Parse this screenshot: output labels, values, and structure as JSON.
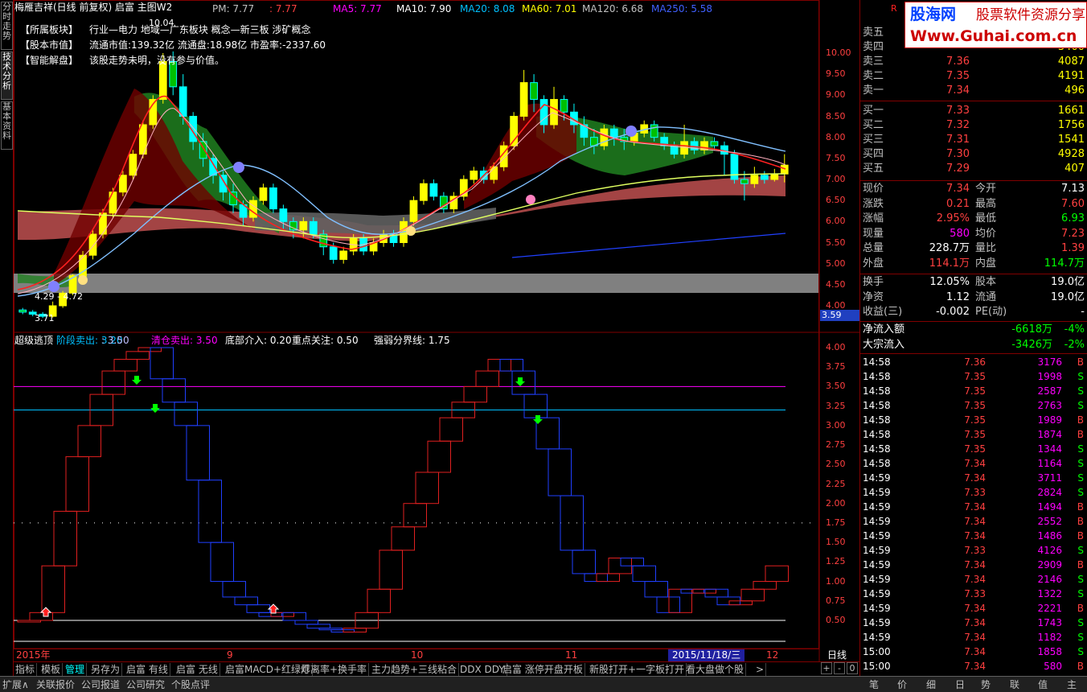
{
  "window": {
    "title": "梅雁吉祥(日线 前复权) 启富 主图W2",
    "pm_label": "PM: 7.77",
    "pm_value": ": 7.77",
    "price_tag": "10.04"
  },
  "ma_legend": [
    {
      "label": "MA5: 7.77",
      "color": "#ff00ff"
    },
    {
      "label": "MA10: 7.90",
      "color": "#ffffff"
    },
    {
      "label": "MA20: 8.08",
      "color": "#00c0ff"
    },
    {
      "label": "MA60: 7.01",
      "color": "#ffff00"
    },
    {
      "label": "MA120: 6.68",
      "color": "#c0c0c0"
    },
    {
      "label": "MA250: 5.58",
      "color": "#4060ff"
    }
  ],
  "info_rows": [
    {
      "label": "【所属板块】",
      "text": "行业—电力    地域—广东板块    概念—新三板 涉矿概念"
    },
    {
      "label": "【股本市值】",
      "text": "流通市值:139.32亿    流通盘:18.98亿    市盈率:-2337.60"
    },
    {
      "label": "【智能解盘】",
      "text": "该股走势未明，没有参与价值。"
    }
  ],
  "left_tabs": [
    "分时走势",
    "技术分析",
    "基本资料"
  ],
  "main_axis": [
    "10.00",
    "9.50",
    "9.00",
    "8.50",
    "8.00",
    "7.50",
    "7.00",
    "6.50",
    "6.00",
    "5.50",
    "5.00",
    "4.50",
    "4.00"
  ],
  "axis_marker": "3.59",
  "chart_annotations": {
    "low_label": "3.71",
    "range_label": "4.29 - 4.72"
  },
  "indicator": {
    "title": "超级逃顶",
    "items": [
      {
        "label": "阶段卖出: 3.20",
        "color": "#00c0ff"
      },
      {
        "label": ": 3.50",
        "color": "#c0c0ff"
      },
      {
        "label": "清仓卖出: 3.50",
        "color": "#ff00ff"
      },
      {
        "label": "底部介入: 0.20",
        "color": "#ffffff"
      },
      {
        "label": "重点关注: 0.50",
        "color": "#ffffff"
      },
      {
        "label": "强弱分界线: 1.75",
        "color": "#ffffff"
      }
    ],
    "axis": [
      "4.00",
      "3.75",
      "3.50",
      "3.25",
      "3.00",
      "2.75",
      "2.50",
      "2.25",
      "2.00",
      "1.75",
      "1.50",
      "1.25",
      "1.00",
      "0.75",
      "0.50"
    ]
  },
  "date_axis": {
    "labels": [
      "2015年",
      "9",
      "10",
      "11",
      "12"
    ],
    "cursor_date": "2015/11/18/三",
    "period": "日线"
  },
  "bottom_tabs": [
    "指标",
    "模板",
    "管理",
    "另存为",
    "启富 有线",
    "启富 无线",
    "启富MACD+红绿灯",
    "乖离率+换手率",
    "主力趋势+三线粘合",
    "DDX DDY",
    "启富 涨停开盘开板",
    "新股打开+一字板打开",
    "看大盘做个股",
    ">"
  ],
  "zoom_buttons": [
    "+",
    "-",
    "0"
  ],
  "status_tabs": [
    "扩展∧",
    "关联报价",
    "公司报道",
    "公司研究",
    "个股点评"
  ],
  "logo": {
    "brand": "股海网",
    "slogan": "股票软件资源分享",
    "url": "Www.Guhai.com.cn",
    "corner_mark": "R"
  },
  "order_book": {
    "asks": [
      {
        "label": "卖五",
        "price": "",
        "vol": ""
      },
      {
        "label": "卖四",
        "price": "",
        "vol": "3400"
      },
      {
        "label": "卖三",
        "price": "7.36",
        "vol": "4087"
      },
      {
        "label": "卖二",
        "price": "7.35",
        "vol": "4191"
      },
      {
        "label": "卖一",
        "price": "7.34",
        "vol": "496"
      }
    ],
    "bids": [
      {
        "label": "买一",
        "price": "7.33",
        "vol": "1661"
      },
      {
        "label": "买二",
        "price": "7.32",
        "vol": "1756"
      },
      {
        "label": "买三",
        "price": "7.31",
        "vol": "1541"
      },
      {
        "label": "买四",
        "price": "7.30",
        "vol": "4928"
      },
      {
        "label": "买五",
        "price": "7.29",
        "vol": "407"
      }
    ]
  },
  "stats": [
    {
      "l1": "现价",
      "v1": "7.34",
      "c1": "#ff4040",
      "l2": "今开",
      "v2": "7.13",
      "c2": "#ffffff"
    },
    {
      "l1": "涨跌",
      "v1": "0.21",
      "c1": "#ff4040",
      "l2": "最高",
      "v2": "7.60",
      "c2": "#ff4040"
    },
    {
      "l1": "涨幅",
      "v1": "2.95%",
      "c1": "#ff4040",
      "l2": "最低",
      "v2": "6.93",
      "c2": "#00ff00"
    },
    {
      "l1": "现量",
      "v1": "580",
      "c1": "#ff00ff",
      "l2": "均价",
      "v2": "7.23",
      "c2": "#ff4040"
    },
    {
      "l1": "总量",
      "v1": "228.7万",
      "c1": "#ffffff",
      "l2": "量比",
      "v2": "1.39",
      "c2": "#ff4040"
    },
    {
      "l1": "外盘",
      "v1": "114.1万",
      "c1": "#ff4040",
      "l2": "内盘",
      "v2": "114.7万",
      "c2": "#00ff00"
    }
  ],
  "stats2": [
    {
      "l1": "换手",
      "v1": "12.05%",
      "l2": "股本",
      "v2": "19.0亿"
    },
    {
      "l1": "净资",
      "v1": "1.12",
      "l2": "流通",
      "v2": "19.0亿"
    },
    {
      "l1": "收益(三)",
      "v1": "-0.002",
      "l2": "PE(动)",
      "v2": "-"
    }
  ],
  "flows": [
    {
      "label": "净流入额",
      "value": "-6618万",
      "pct": "-4%"
    },
    {
      "label": "大宗流入",
      "value": "-3426万",
      "pct": "-2%"
    }
  ],
  "ticks": [
    {
      "t": "14:58",
      "p": "7.36",
      "v": "3176",
      "d": "B"
    },
    {
      "t": "14:58",
      "p": "7.35",
      "v": "1998",
      "d": "S"
    },
    {
      "t": "14:58",
      "p": "7.35",
      "v": "2587",
      "d": "S"
    },
    {
      "t": "14:58",
      "p": "7.35",
      "v": "2763",
      "d": "S"
    },
    {
      "t": "14:58",
      "p": "7.35",
      "v": "1989",
      "d": "B"
    },
    {
      "t": "14:58",
      "p": "7.35",
      "v": "1874",
      "d": "B"
    },
    {
      "t": "14:58",
      "p": "7.35",
      "v": "1344",
      "d": "S"
    },
    {
      "t": "14:58",
      "p": "7.34",
      "v": "1164",
      "d": "S"
    },
    {
      "t": "14:59",
      "p": "7.34",
      "v": "3711",
      "d": "S"
    },
    {
      "t": "14:59",
      "p": "7.33",
      "v": "2824",
      "d": "S"
    },
    {
      "t": "14:59",
      "p": "7.34",
      "v": "1494",
      "d": "B"
    },
    {
      "t": "14:59",
      "p": "7.34",
      "v": "2552",
      "d": "B"
    },
    {
      "t": "14:59",
      "p": "7.34",
      "v": "1486",
      "d": "B"
    },
    {
      "t": "14:59",
      "p": "7.33",
      "v": "4126",
      "d": "S"
    },
    {
      "t": "14:59",
      "p": "7.34",
      "v": "2909",
      "d": "B"
    },
    {
      "t": "14:59",
      "p": "7.34",
      "v": "2146",
      "d": "S"
    },
    {
      "t": "14:59",
      "p": "7.33",
      "v": "1322",
      "d": "S"
    },
    {
      "t": "14:59",
      "p": "7.34",
      "v": "2221",
      "d": "B"
    },
    {
      "t": "14:59",
      "p": "7.34",
      "v": "1743",
      "d": "S"
    },
    {
      "t": "14:59",
      "p": "7.34",
      "v": "1182",
      "d": "S"
    },
    {
      "t": "15:00",
      "p": "7.34",
      "v": "1858",
      "d": "S"
    },
    {
      "t": "15:00",
      "p": "7.34",
      "v": "580",
      "d": "B"
    }
  ],
  "quote_bottom_tabs": [
    "笔",
    "价",
    "细",
    "日",
    "势",
    "联",
    "值",
    "主"
  ],
  "chart_data": [
    {
      "type": "candlestick",
      "series_name": "梅雁吉祥",
      "ylim": [
        3.6,
        10.3
      ],
      "axis_ticks": [
        4.0,
        4.5,
        5.0,
        5.5,
        6.0,
        6.5,
        7.0,
        7.5,
        8.0,
        8.5,
        9.0,
        9.5,
        10.0
      ],
      "candles": [
        [
          3.9,
          3.85,
          3.95,
          3.8
        ],
        [
          3.85,
          3.8,
          3.9,
          3.75
        ],
        [
          3.8,
          3.75,
          3.85,
          3.71
        ],
        [
          3.75,
          4.0,
          4.1,
          3.72
        ],
        [
          4.0,
          4.3,
          4.35,
          3.95
        ],
        [
          4.3,
          4.72,
          4.75,
          4.25
        ],
        [
          4.7,
          5.2,
          5.3,
          4.6
        ],
        [
          5.2,
          5.7,
          5.8,
          5.1
        ],
        [
          5.7,
          6.2,
          6.3,
          5.6
        ],
        [
          6.2,
          6.7,
          6.8,
          6.1
        ],
        [
          6.7,
          7.1,
          7.2,
          6.6
        ],
        [
          7.1,
          7.6,
          7.7,
          7.0
        ],
        [
          7.6,
          8.3,
          8.4,
          7.5
        ],
        [
          8.3,
          8.9,
          9.0,
          8.2
        ],
        [
          8.9,
          9.8,
          10.0,
          8.8
        ],
        [
          9.8,
          9.2,
          10.04,
          9.0
        ],
        [
          9.2,
          8.5,
          9.5,
          8.3
        ],
        [
          8.5,
          7.9,
          8.6,
          7.7
        ],
        [
          7.9,
          7.5,
          8.1,
          7.3
        ],
        [
          7.5,
          7.1,
          7.6,
          6.9
        ],
        [
          7.1,
          6.7,
          7.2,
          6.5
        ],
        [
          6.7,
          6.4,
          6.9,
          6.2
        ],
        [
          6.4,
          6.1,
          6.5,
          5.9
        ],
        [
          6.1,
          6.5,
          6.6,
          6.0
        ],
        [
          6.5,
          6.8,
          6.9,
          6.4
        ],
        [
          6.8,
          6.3,
          6.9,
          6.2
        ],
        [
          6.3,
          6.0,
          6.4,
          5.8
        ],
        [
          6.0,
          5.8,
          6.1,
          5.6
        ],
        [
          5.8,
          6.0,
          6.1,
          5.6
        ],
        [
          6.0,
          5.7,
          6.1,
          5.6
        ],
        [
          5.7,
          5.4,
          5.8,
          5.2
        ],
        [
          5.4,
          5.1,
          5.5,
          5.0
        ],
        [
          5.1,
          5.3,
          5.4,
          5.0
        ],
        [
          5.3,
          5.6,
          5.7,
          5.2
        ],
        [
          5.6,
          5.3,
          5.7,
          5.2
        ],
        [
          5.3,
          5.5,
          5.6,
          5.2
        ],
        [
          5.5,
          5.7,
          5.8,
          5.4
        ],
        [
          5.7,
          5.5,
          5.8,
          5.4
        ],
        [
          5.5,
          6.0,
          6.1,
          5.4
        ],
        [
          6.0,
          6.5,
          6.6,
          5.9
        ],
        [
          6.5,
          6.9,
          7.0,
          6.4
        ],
        [
          6.9,
          6.6,
          7.0,
          6.5
        ],
        [
          6.6,
          6.3,
          6.7,
          6.2
        ],
        [
          6.3,
          6.6,
          6.7,
          6.2
        ],
        [
          6.6,
          7.0,
          7.1,
          6.5
        ],
        [
          7.0,
          7.2,
          7.3,
          6.9
        ],
        [
          7.2,
          7.0,
          7.3,
          6.9
        ],
        [
          7.0,
          7.3,
          7.4,
          6.9
        ],
        [
          7.3,
          7.8,
          7.9,
          7.2
        ],
        [
          7.8,
          8.5,
          8.6,
          7.7
        ],
        [
          8.5,
          9.3,
          9.6,
          8.4
        ],
        [
          9.3,
          8.9,
          9.5,
          8.6
        ],
        [
          8.9,
          8.3,
          9.0,
          8.1
        ],
        [
          8.3,
          8.9,
          9.2,
          8.2
        ],
        [
          8.9,
          8.6,
          9.0,
          8.4
        ],
        [
          8.6,
          8.3,
          8.8,
          8.1
        ],
        [
          8.3,
          8.0,
          8.5,
          7.8
        ],
        [
          8.0,
          7.8,
          8.2,
          7.6
        ],
        [
          7.8,
          8.2,
          8.3,
          7.7
        ],
        [
          8.2,
          8.0,
          8.3,
          7.8
        ],
        [
          8.0,
          7.9,
          8.2,
          7.7
        ],
        [
          7.9,
          8.1,
          8.2,
          7.8
        ],
        [
          8.1,
          8.3,
          8.4,
          8.0
        ],
        [
          8.3,
          8.0,
          8.4,
          7.9
        ],
        [
          8.0,
          7.8,
          8.1,
          7.7
        ],
        [
          7.8,
          7.6,
          7.9,
          7.5
        ],
        [
          7.6,
          7.9,
          8.3,
          7.5
        ],
        [
          7.9,
          7.7,
          8.0,
          7.6
        ],
        [
          7.7,
          7.9,
          8.0,
          7.6
        ],
        [
          7.9,
          7.8,
          8.0,
          7.7
        ],
        [
          7.8,
          7.6,
          7.9,
          7.1
        ],
        [
          7.6,
          7.0,
          7.7,
          6.9
        ],
        [
          7.0,
          6.9,
          7.2,
          6.5
        ],
        [
          6.9,
          7.1,
          7.3,
          6.8
        ],
        [
          7.1,
          7.0,
          7.2,
          6.9
        ],
        [
          7.0,
          7.13,
          7.25,
          6.95
        ],
        [
          7.13,
          7.34,
          7.6,
          6.93
        ]
      ]
    },
    {
      "type": "line",
      "series_name": "超级逃顶",
      "ylim": [
        0.3,
        4.1
      ],
      "axis_ticks": [
        0.5,
        0.75,
        1.0,
        1.25,
        1.5,
        1.75,
        2.0,
        2.25,
        2.5,
        2.75,
        3.0,
        3.25,
        3.5,
        3.75,
        4.0
      ],
      "reference_lines": [
        {
          "name": "清仓卖出",
          "value": 3.5,
          "color": "#ff00ff"
        },
        {
          "name": "阶段卖出",
          "value": 3.2,
          "color": "#00c0ff"
        },
        {
          "name": "强弱分界线",
          "value": 1.75,
          "color": "#ffffff"
        },
        {
          "name": "重点关注",
          "value": 0.5,
          "color": "#ffffff"
        },
        {
          "name": "底部介入",
          "value": 0.2,
          "color": "#ffffff"
        }
      ],
      "values": [
        0.5,
        0.5,
        0.6,
        1.2,
        1.9,
        2.6,
        3.0,
        3.4,
        3.7,
        3.85,
        3.95,
        4.0,
        3.6,
        3.3,
        3.0,
        2.3,
        1.5,
        1.0,
        0.8,
        0.7,
        0.6,
        0.55,
        0.6,
        0.5,
        0.45,
        0.4,
        0.38,
        0.35,
        0.4,
        0.6,
        0.9,
        1.4,
        1.7,
        2.0,
        2.4,
        2.8,
        3.1,
        3.3,
        3.5,
        3.7,
        3.85,
        3.7,
        3.4,
        3.1,
        2.7,
        2.1,
        1.4,
        1.1,
        1.0,
        1.1,
        1.3,
        1.2,
        1.0,
        0.8,
        0.6,
        0.9,
        0.85,
        0.9,
        0.8,
        0.7,
        0.75,
        0.9,
        1.0,
        1.2
      ]
    }
  ]
}
